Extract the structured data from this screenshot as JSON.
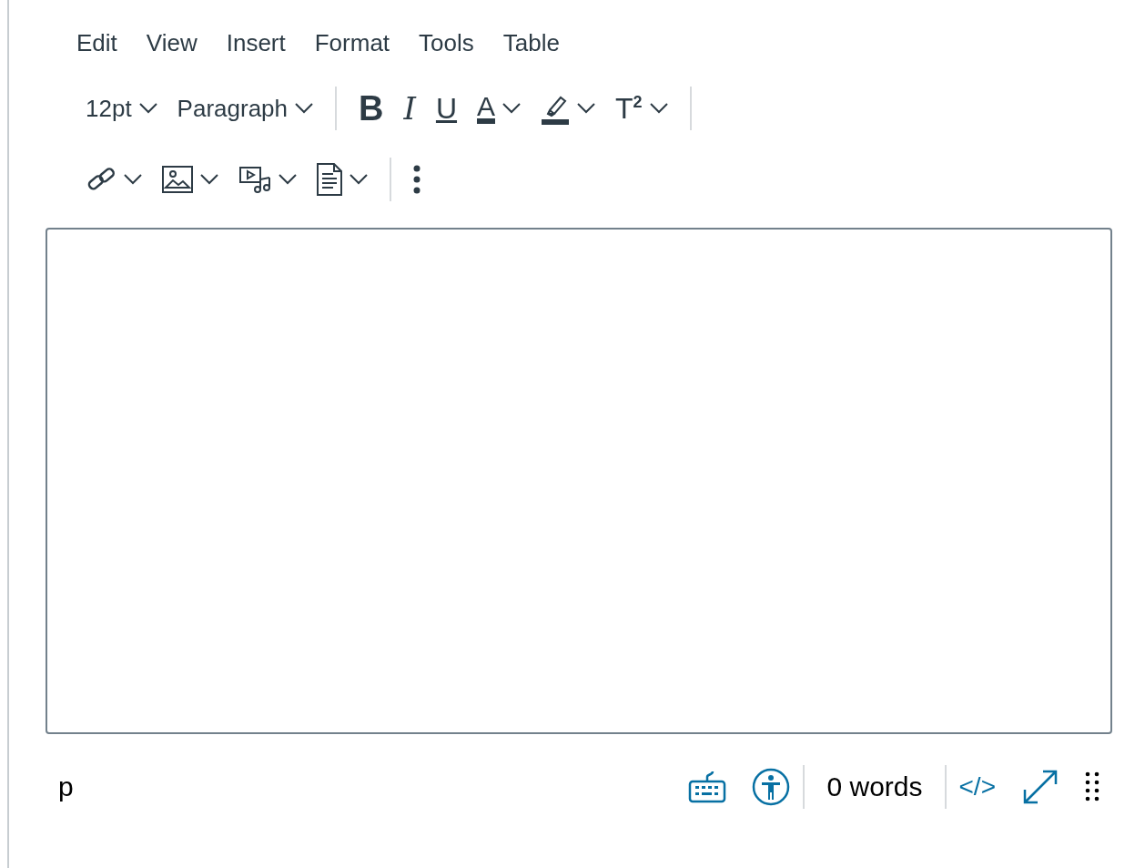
{
  "menu_bar": [
    "Edit",
    "View",
    "Insert",
    "Format",
    "Tools",
    "Table"
  ],
  "toolbar_rows": [
    [
      [
        {
          "kind": "select",
          "label": "12pt"
        },
        {
          "kind": "select",
          "label": "Paragraph"
        }
      ],
      [
        {
          "kind": "bold",
          "glyph": "B"
        },
        {
          "kind": "italic",
          "glyph": "I"
        },
        {
          "kind": "underline",
          "glyph": "U"
        },
        {
          "kind": "text-color",
          "glyph": "A"
        },
        {
          "kind": "highlight"
        },
        {
          "kind": "superscript",
          "glyph": "T$^{2}$"
        }
      ],
      []
    ],
    [
      [
        {
          "kind": "link"
        },
        {
          "kind": "image"
        },
        {
          "kind": "media"
        },
        {
          "kind": "document"
        }
      ],
      [
        {
          "kind": "more"
        }
      ]
    ]
  ],
  "status_bar": {
    "path": "p",
    "word_count": "0 words",
    "html_toggle": "</>"
  }
}
